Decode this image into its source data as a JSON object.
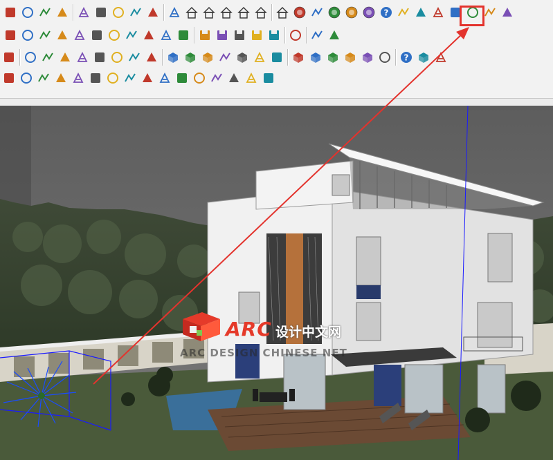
{
  "window": {
    "viewport_label": "3D model viewport - villa scene"
  },
  "toolbars": {
    "row1": [
      "paint-bucket-icon",
      "eraser-icon",
      "orbit-icon",
      "pan-icon",
      "zoom-icon",
      "zoom-extents-icon",
      "previous-view-icon",
      "component-icon",
      "layer-icon",
      "export-icon",
      "house-front-icon",
      "door-icon",
      "house-icon",
      "house-side-icon",
      "house-outline-icon",
      "warehouse-icon",
      "m-badge-icon",
      "tag-icon",
      "r-badge-icon",
      "rt-badge-icon",
      "br-badge-icon",
      "help-icon",
      "label-icon",
      "diamond-icon",
      "pencil-icon",
      "plant-icon",
      "terrain-icon",
      "target-icon",
      "pause-icon"
    ],
    "row2": [
      "circle-icon",
      "arc-icon",
      "freehand-icon",
      "arc-tool-icon",
      "arc2-icon",
      "arc3-icon",
      "zigzag-icon",
      "polygon-icon",
      "wrench-icon",
      "ellipse-icon",
      "triangle-icon",
      "save-red-icon",
      "save-blue-icon",
      "save-green-icon",
      "save-purple-icon",
      "save-grey-icon",
      "note-icon",
      "brush-icon",
      "eraser-red-icon"
    ],
    "row3": [
      "bookmark-icon",
      "scale-icon",
      "line-red-icon",
      "arrow-left-icon",
      "line-yellow-icon",
      "line-green-icon",
      "gear-icon",
      "building-icon",
      "chart-icon",
      "cube-blue-icon",
      "cube-outline-icon",
      "box-icon",
      "page-icon",
      "cube-grey-icon",
      "layers-icon",
      "page-blue-icon",
      "cube-orange-icon",
      "box-orange-icon",
      "frame-orange-icon",
      "tile-orange-icon",
      "tile-orange2-icon",
      "cursor-icon",
      "question-icon",
      "image-frame-icon",
      "film-icon"
    ],
    "row4": [
      "grid-icon",
      "flag-icon",
      "arrows-icon",
      "shield-icon",
      "ds-icon",
      "wand-icon",
      "export-blue-icon",
      "settings-icon",
      "magic-icon",
      "sparkle-icon",
      "brush2-icon",
      "printer-icon",
      "search-doc-icon",
      "book-icon",
      "clapper-icon",
      "gif-icon"
    ]
  },
  "watermark": {
    "brand": "ARC",
    "chinese": "设计中文网",
    "english": "ARC DESIGN CHINESE NET"
  },
  "colors": {
    "annotation": "#e3332d",
    "toolbar_bg": "#f2f2f2",
    "sky": "#6b6b6b",
    "wall": "#ececec"
  }
}
